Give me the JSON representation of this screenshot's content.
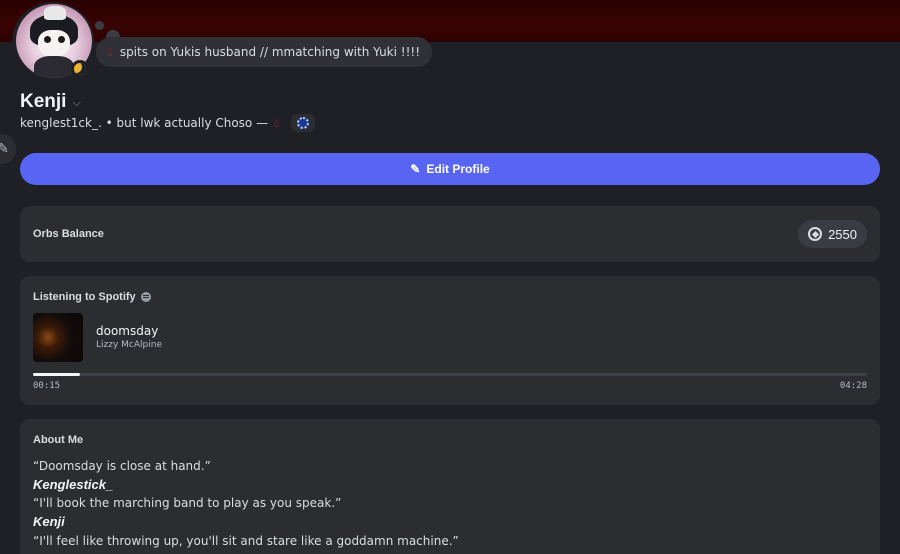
{
  "profile": {
    "display_name": "Kenji",
    "status_text": "spits on Yukis husband  // mmatching with Yuki !!!!",
    "handle_line": "kenglest1ck_. • but lwk actually Choso —",
    "status_color": "#f0b232",
    "banner_color": "#3a0303"
  },
  "actions": {
    "edit_profile": "Edit Profile",
    "accent": "#5865f2"
  },
  "orbs": {
    "title": "Orbs Balance",
    "balance": "2550"
  },
  "spotify": {
    "title": "Listening to Spotify",
    "song": "doomsday",
    "artist": "Lizzy McAlpine",
    "elapsed": "00:15",
    "duration": "04:28",
    "progress_fraction": 0.056
  },
  "about": {
    "title": "About Me",
    "lines": [
      "“Doomsday is close at hand.”",
      "Kenglestick_",
      "“I'll book the marching band to play as you speak.”",
      "Kenji",
      "“I'll feel like throwing up, you'll sit and stare like a goddamn machine.”"
    ]
  }
}
